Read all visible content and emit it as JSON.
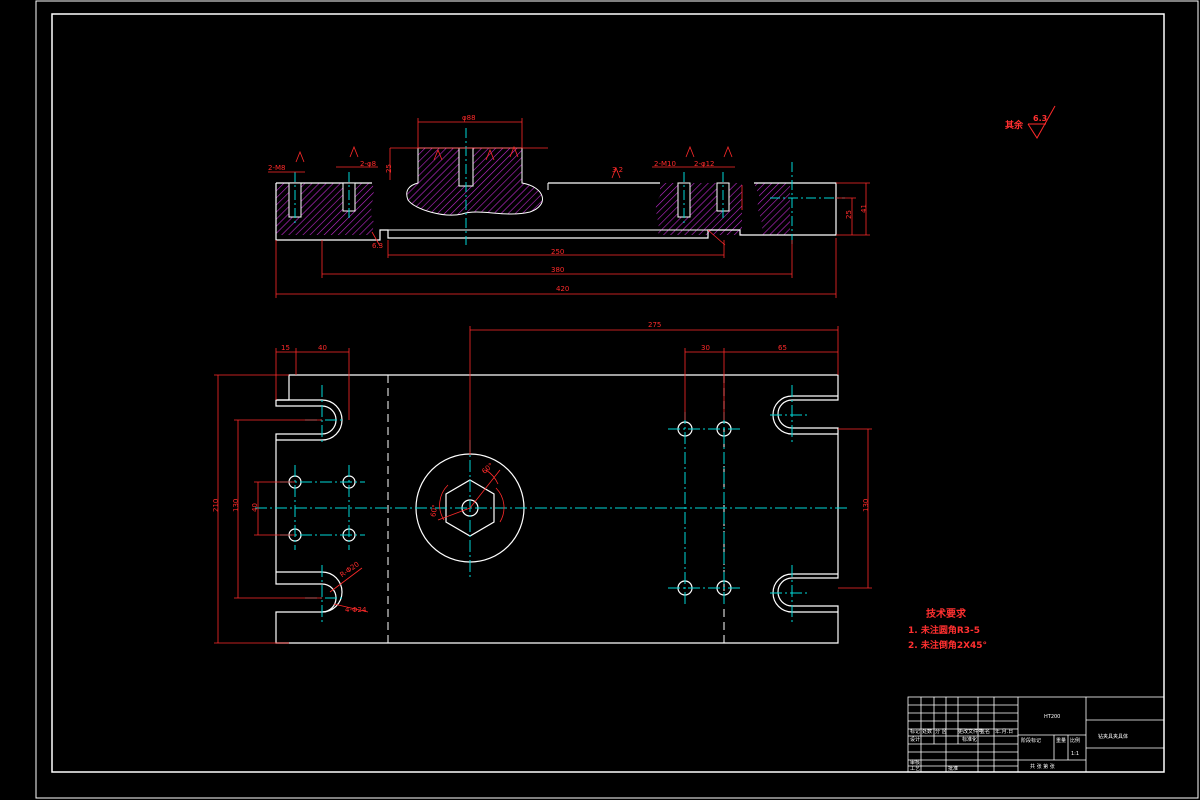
{
  "drawing": {
    "section_dims": {
      "d_top": "φ88",
      "d_total": "420",
      "d_380": "380",
      "d_250": "250",
      "d_h1": "25",
      "d_h2": "41",
      "d_side": "25",
      "hole_left_a": "2-M8",
      "hole_left_b": "2-φ8",
      "hole_right_a": "2-M10",
      "hole_right_b": "2-φ12",
      "rough_a": "3.2",
      "rough_b": "6.3"
    },
    "plan_dims": {
      "d_275": "275",
      "d_15": "15",
      "d_40": "40",
      "d_30": "30",
      "d_65": "65",
      "d_height": "210",
      "d_inner": "130",
      "d_40v": "40",
      "d_right": "130",
      "slot_a": "R-Φ20",
      "slot_b": "4-Φ24",
      "angle_a": "60°",
      "angle_b": "60°"
    },
    "roughness": {
      "label": "其余",
      "value": "6.3"
    },
    "tech_requirements": {
      "title": "技术要求",
      "item1": "1. 未注圆角R3-5",
      "item2": "2. 未注倒角2X45°"
    },
    "title_block": {
      "material": "HT200",
      "part_name": "钻夹具夹具体",
      "scale": "1:1",
      "c1": "标记",
      "c2": "处数",
      "c3": "分 区",
      "c4": "更改文件号",
      "c5": "签名",
      "c6": "年.月.日",
      "r_design": "设计",
      "r_std": "标准化",
      "r_stage": "阶段标记",
      "r_weight": "重量",
      "r_ratio": "比例",
      "r_review": "审核",
      "r_process": "工艺",
      "r_approve": "批准",
      "r_sheet": "共 张 第 张"
    },
    "colors": {
      "outline": "#ffffff",
      "dimension": "#ff2a2a",
      "centerline": "#00d8d8",
      "hatch": "#c02ad0"
    }
  }
}
